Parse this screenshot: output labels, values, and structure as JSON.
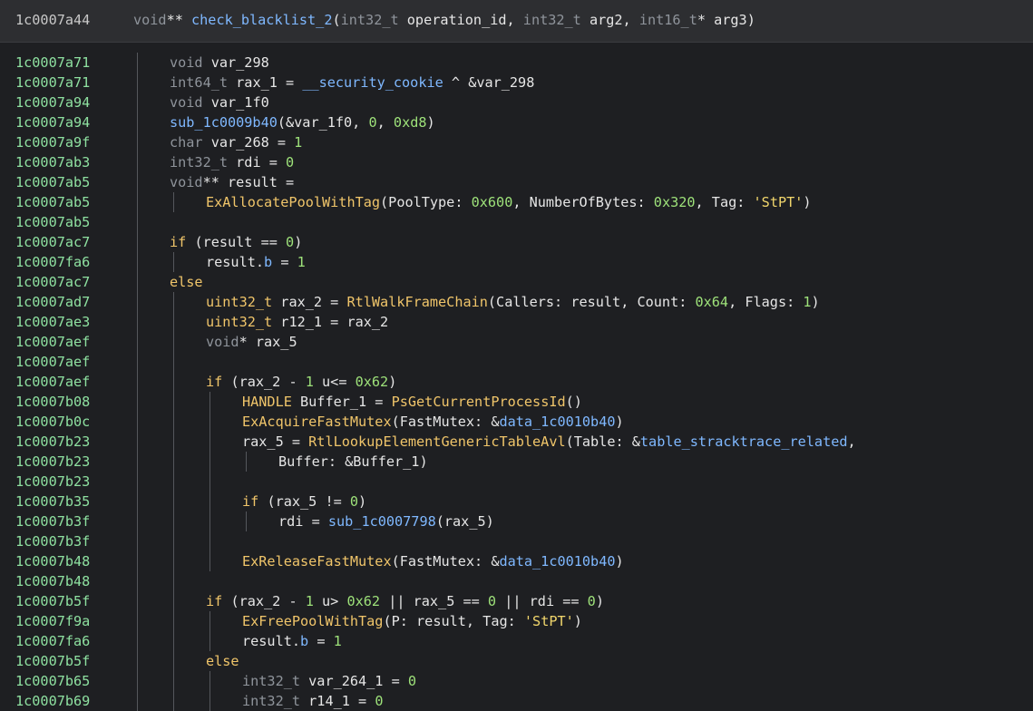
{
  "header": {
    "address": "1c0007a44",
    "signature_parts": [
      {
        "t": "void",
        "c": "kw"
      },
      {
        "t": "** ",
        "c": "op"
      },
      {
        "t": "check_blacklist_2",
        "c": "sym"
      },
      {
        "t": "(",
        "c": "op"
      },
      {
        "t": "int32_t",
        "c": "kw"
      },
      {
        "t": " operation_id, ",
        "c": "op"
      },
      {
        "t": "int32_t",
        "c": "kw"
      },
      {
        "t": " arg2, ",
        "c": "op"
      },
      {
        "t": "int16_t",
        "c": "kw"
      },
      {
        "t": "* arg3)",
        "c": "op"
      }
    ]
  },
  "lines": [
    {
      "addr": "1c0007a71",
      "indent": 0,
      "parts": [
        {
          "t": "void",
          "c": "kw"
        },
        {
          "t": " var_298",
          "c": "var"
        }
      ]
    },
    {
      "addr": "1c0007a71",
      "indent": 0,
      "parts": [
        {
          "t": "int64_t",
          "c": "kw"
        },
        {
          "t": " rax_1 = ",
          "c": "var"
        },
        {
          "t": "__security_cookie",
          "c": "sym"
        },
        {
          "t": " ^ &var_298",
          "c": "var"
        }
      ]
    },
    {
      "addr": "1c0007a94",
      "indent": 0,
      "parts": [
        {
          "t": "void",
          "c": "kw"
        },
        {
          "t": " var_1f0",
          "c": "var"
        }
      ]
    },
    {
      "addr": "1c0007a94",
      "indent": 0,
      "parts": [
        {
          "t": "sub_1c0009b40",
          "c": "sym"
        },
        {
          "t": "(&var_1f0, ",
          "c": "var"
        },
        {
          "t": "0",
          "c": "num"
        },
        {
          "t": ", ",
          "c": "var"
        },
        {
          "t": "0xd8",
          "c": "num"
        },
        {
          "t": ")",
          "c": "var"
        }
      ]
    },
    {
      "addr": "1c0007a9f",
      "indent": 0,
      "parts": [
        {
          "t": "char",
          "c": "kw"
        },
        {
          "t": " var_268 = ",
          "c": "var"
        },
        {
          "t": "1",
          "c": "num"
        }
      ]
    },
    {
      "addr": "1c0007ab3",
      "indent": 0,
      "parts": [
        {
          "t": "int32_t",
          "c": "kw"
        },
        {
          "t": " rdi = ",
          "c": "var"
        },
        {
          "t": "0",
          "c": "num"
        }
      ]
    },
    {
      "addr": "1c0007ab5",
      "indent": 0,
      "parts": [
        {
          "t": "void",
          "c": "kw"
        },
        {
          "t": "** result =",
          "c": "var"
        }
      ]
    },
    {
      "addr": "1c0007ab5",
      "indent": 1,
      "parts": [
        {
          "t": "ExAllocatePoolWithTag",
          "c": "fn"
        },
        {
          "t": "(PoolType: ",
          "c": "var"
        },
        {
          "t": "0x600",
          "c": "num"
        },
        {
          "t": ", NumberOfBytes: ",
          "c": "var"
        },
        {
          "t": "0x320",
          "c": "num"
        },
        {
          "t": ", Tag: ",
          "c": "var"
        },
        {
          "t": "'StPT'",
          "c": "str"
        },
        {
          "t": ")",
          "c": "var"
        }
      ]
    },
    {
      "addr": "1c0007ab5",
      "indent": 0,
      "parts": []
    },
    {
      "addr": "1c0007ac7",
      "indent": 0,
      "parts": [
        {
          "t": "if",
          "c": "fn"
        },
        {
          "t": " (result == ",
          "c": "var"
        },
        {
          "t": "0",
          "c": "num"
        },
        {
          "t": ")",
          "c": "var"
        }
      ]
    },
    {
      "addr": "1c0007fa6",
      "indent": 1,
      "parts": [
        {
          "t": "result.",
          "c": "var"
        },
        {
          "t": "b",
          "c": "sym"
        },
        {
          "t": " = ",
          "c": "var"
        },
        {
          "t": "1",
          "c": "num"
        }
      ]
    },
    {
      "addr": "1c0007ac7",
      "indent": 0,
      "parts": [
        {
          "t": "else",
          "c": "fn"
        }
      ]
    },
    {
      "addr": "1c0007ad7",
      "indent": 1,
      "parts": [
        {
          "t": "uint32_t",
          "c": "fn"
        },
        {
          "t": " rax_2 = ",
          "c": "var"
        },
        {
          "t": "RtlWalkFrameChain",
          "c": "fn"
        },
        {
          "t": "(Callers: result, Count: ",
          "c": "var"
        },
        {
          "t": "0x64",
          "c": "num"
        },
        {
          "t": ", Flags: ",
          "c": "var"
        },
        {
          "t": "1",
          "c": "num"
        },
        {
          "t": ")",
          "c": "var"
        }
      ]
    },
    {
      "addr": "1c0007ae3",
      "indent": 1,
      "parts": [
        {
          "t": "uint32_t",
          "c": "fn"
        },
        {
          "t": " r12_1 = rax_2",
          "c": "var"
        }
      ]
    },
    {
      "addr": "1c0007aef",
      "indent": 1,
      "parts": [
        {
          "t": "void",
          "c": "kw"
        },
        {
          "t": "* rax_5",
          "c": "var"
        }
      ]
    },
    {
      "addr": "1c0007aef",
      "indent": 1,
      "parts": []
    },
    {
      "addr": "1c0007aef",
      "indent": 1,
      "parts": [
        {
          "t": "if",
          "c": "fn"
        },
        {
          "t": " (rax_2 - ",
          "c": "var"
        },
        {
          "t": "1",
          "c": "num"
        },
        {
          "t": " u<= ",
          "c": "var"
        },
        {
          "t": "0x62",
          "c": "num"
        },
        {
          "t": ")",
          "c": "var"
        }
      ]
    },
    {
      "addr": "1c0007b08",
      "indent": 2,
      "parts": [
        {
          "t": "HANDLE",
          "c": "fn"
        },
        {
          "t": " Buffer_1 = ",
          "c": "var"
        },
        {
          "t": "PsGetCurrentProcessId",
          "c": "fn"
        },
        {
          "t": "()",
          "c": "var"
        }
      ]
    },
    {
      "addr": "1c0007b0c",
      "indent": 2,
      "parts": [
        {
          "t": "ExAcquireFastMutex",
          "c": "fn"
        },
        {
          "t": "(FastMutex: &",
          "c": "var"
        },
        {
          "t": "data_1c0010b40",
          "c": "sym"
        },
        {
          "t": ")",
          "c": "var"
        }
      ]
    },
    {
      "addr": "1c0007b23",
      "indent": 2,
      "parts": [
        {
          "t": "rax_5 = ",
          "c": "var"
        },
        {
          "t": "RtlLookupElementGenericTableAvl",
          "c": "fn"
        },
        {
          "t": "(Table: &",
          "c": "var"
        },
        {
          "t": "table_stracktrace_related",
          "c": "sym"
        },
        {
          "t": ",",
          "c": "var"
        }
      ]
    },
    {
      "addr": "1c0007b23",
      "indent": 3,
      "parts": [
        {
          "t": "Buffer: &Buffer_1)",
          "c": "var"
        }
      ]
    },
    {
      "addr": "1c0007b23",
      "indent": 2,
      "parts": []
    },
    {
      "addr": "1c0007b35",
      "indent": 2,
      "parts": [
        {
          "t": "if",
          "c": "fn"
        },
        {
          "t": " (rax_5 != ",
          "c": "var"
        },
        {
          "t": "0",
          "c": "num"
        },
        {
          "t": ")",
          "c": "var"
        }
      ]
    },
    {
      "addr": "1c0007b3f",
      "indent": 3,
      "parts": [
        {
          "t": "rdi = ",
          "c": "var"
        },
        {
          "t": "sub_1c0007798",
          "c": "sym"
        },
        {
          "t": "(rax_5)",
          "c": "var"
        }
      ]
    },
    {
      "addr": "1c0007b3f",
      "indent": 2,
      "parts": []
    },
    {
      "addr": "1c0007b48",
      "indent": 2,
      "parts": [
        {
          "t": "ExReleaseFastMutex",
          "c": "fn"
        },
        {
          "t": "(FastMutex: &",
          "c": "var"
        },
        {
          "t": "data_1c0010b40",
          "c": "sym"
        },
        {
          "t": ")",
          "c": "var"
        }
      ]
    },
    {
      "addr": "1c0007b48",
      "indent": 1,
      "parts": []
    },
    {
      "addr": "1c0007b5f",
      "indent": 1,
      "parts": [
        {
          "t": "if",
          "c": "fn"
        },
        {
          "t": " (rax_2 - ",
          "c": "var"
        },
        {
          "t": "1",
          "c": "num"
        },
        {
          "t": " u> ",
          "c": "var"
        },
        {
          "t": "0x62",
          "c": "num"
        },
        {
          "t": " || rax_5 == ",
          "c": "var"
        },
        {
          "t": "0",
          "c": "num"
        },
        {
          "t": " || rdi == ",
          "c": "var"
        },
        {
          "t": "0",
          "c": "num"
        },
        {
          "t": ")",
          "c": "var"
        }
      ]
    },
    {
      "addr": "1c0007f9a",
      "indent": 2,
      "parts": [
        {
          "t": "ExFreePoolWithTag",
          "c": "fn"
        },
        {
          "t": "(P: result, Tag: ",
          "c": "var"
        },
        {
          "t": "'StPT'",
          "c": "str"
        },
        {
          "t": ")",
          "c": "var"
        }
      ]
    },
    {
      "addr": "1c0007fa6",
      "indent": 2,
      "parts": [
        {
          "t": "result.",
          "c": "var"
        },
        {
          "t": "b",
          "c": "sym"
        },
        {
          "t": " = ",
          "c": "var"
        },
        {
          "t": "1",
          "c": "num"
        }
      ]
    },
    {
      "addr": "1c0007b5f",
      "indent": 1,
      "parts": [
        {
          "t": "else",
          "c": "fn"
        }
      ]
    },
    {
      "addr": "1c0007b65",
      "indent": 2,
      "parts": [
        {
          "t": "int32_t",
          "c": "kw"
        },
        {
          "t": " var_264_1 = ",
          "c": "var"
        },
        {
          "t": "0",
          "c": "num"
        }
      ]
    },
    {
      "addr": "1c0007b69",
      "indent": 2,
      "parts": [
        {
          "t": "int32_t",
          "c": "kw"
        },
        {
          "t": " r14_1 = ",
          "c": "var"
        },
        {
          "t": "0",
          "c": "num"
        }
      ]
    }
  ]
}
